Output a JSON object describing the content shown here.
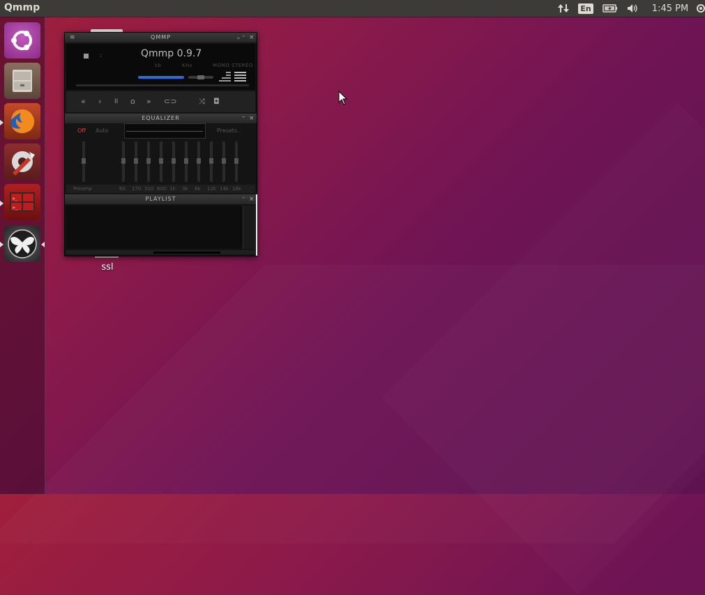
{
  "topbar": {
    "app_title": "Qmmp",
    "keyboard_layout": "En",
    "clock": "1:45 PM",
    "icons": [
      "network-icon",
      "keyboard-layout-indicator",
      "battery-icon",
      "volume-icon",
      "session-gear-icon"
    ]
  },
  "launcher": {
    "items": [
      {
        "name": "ubuntu-dash",
        "icon": "ubuntu-logo-icon",
        "running": false
      },
      {
        "name": "files",
        "icon": "file-cabinet-icon",
        "running": false
      },
      {
        "name": "firefox",
        "icon": "firefox-icon",
        "running": true
      },
      {
        "name": "system-settings",
        "icon": "settings-wrench-gear-icon",
        "running": false
      },
      {
        "name": "terminal-app",
        "icon": "terminal-grid-icon",
        "running": true
      },
      {
        "name": "qmmp",
        "icon": "butterfly-icon",
        "running": true,
        "focused": true
      }
    ]
  },
  "desktop": {
    "icon_label": "ssl"
  },
  "qmmp": {
    "main_title": "QMMP",
    "title": "Qmmp 0.9.7",
    "time_display": ":",
    "labels": {
      "kb": "kb",
      "khz": "KHz",
      "mono": "MONO",
      "stereo": "STEREO"
    },
    "volume_level": 1.0,
    "balance_level": 0.5,
    "controls": [
      "«",
      "›",
      "||",
      "o",
      "»",
      "⊂⊃",
      "⤨",
      "◘"
    ],
    "equalizer": {
      "title": "EQUALIZER",
      "off": "Off",
      "auto": "Auto",
      "presets": "Presets..",
      "preamp": "Preamp",
      "bands": [
        "60",
        "170",
        "310",
        "600",
        "1k",
        "3k",
        "6k",
        "12k",
        "14k",
        "16k"
      ]
    },
    "playlist": {
      "title": "PLAYLIST"
    }
  }
}
